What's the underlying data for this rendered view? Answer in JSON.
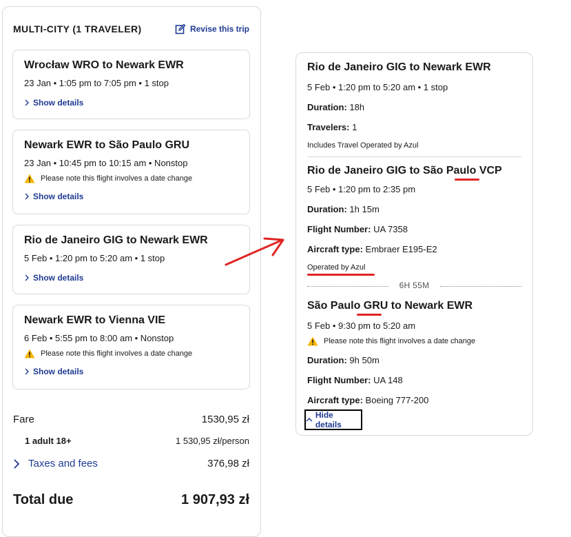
{
  "left_panel": {
    "title": "MULTI-CITY (1 TRAVELER)",
    "revise_label": "Revise this trip",
    "segments": [
      {
        "route": "Wrocław WRO to Newark EWR",
        "schedule": "23 Jan • 1:05 pm to 7:05 pm • 1 stop",
        "warning": "",
        "toggle": "Show details"
      },
      {
        "route": "Newark EWR to São Paulo GRU",
        "schedule": "23 Jan • 10:45 pm to 10:15 am • Nonstop",
        "warning": "Please note this flight involves a date change",
        "toggle": "Show details"
      },
      {
        "route": "Rio de Janeiro GIG to Newark EWR",
        "schedule": "5 Feb • 1:20 pm to 5:20 am • 1 stop",
        "warning": "",
        "toggle": "Show details"
      },
      {
        "route": "Newark EWR to Vienna VIE",
        "schedule": "6 Feb • 5:55 pm to 8:00 am • Nonstop",
        "warning": "Please note this flight involves a date change",
        "toggle": "Show details"
      }
    ],
    "fare": {
      "fare_label": "Fare",
      "fare_value": "1530,95 zł",
      "adult_label": "1 adult 18+",
      "adult_value": "1 530,95 zł/person",
      "taxes_label": "Taxes and fees",
      "taxes_value": "376,98 zł",
      "total_label": "Total due",
      "total_value": "1 907,93 zł"
    }
  },
  "right_panel": {
    "header": {
      "route": "Rio de Janeiro GIG to Newark EWR",
      "schedule": "5 Feb • 1:20 pm to 5:20 am • 1 stop",
      "duration_label": "Duration:",
      "duration_value": "18h",
      "travelers_label": "Travelers:",
      "travelers_value": "1",
      "operated_note": "Includes Travel Operated by Azul"
    },
    "leg1": {
      "route_prefix": "Rio de Janeiro GIG to São Paulo ",
      "route_code": "VCP",
      "schedule": "5 Feb • 1:20 pm to 2:35 pm",
      "duration_label": "Duration:",
      "duration_value": "1h 15m",
      "flight_label": "Flight Number:",
      "flight_value": "UA 7358",
      "aircraft_label": "Aircraft type:",
      "aircraft_value": "Embraer E195-E2",
      "operated": "Operated by Azul"
    },
    "layover": "6H 55M",
    "leg2": {
      "route_prefix": "São Paulo ",
      "route_code": "GRU",
      "route_suffix": " to Newark EWR",
      "schedule": "5 Feb • 9:30 pm to 5:20 am",
      "warning": "Please note this flight involves a date change",
      "duration_label": "Duration:",
      "duration_value": "9h 50m",
      "flight_label": "Flight Number:",
      "flight_value": "UA 148",
      "aircraft_label": "Aircraft type:",
      "aircraft_value": "Boeing 777-200"
    },
    "hide_label": "Hide details"
  },
  "colors": {
    "link": "#1f3a93",
    "annotation": "#e02424",
    "warning": "#f5b400"
  }
}
